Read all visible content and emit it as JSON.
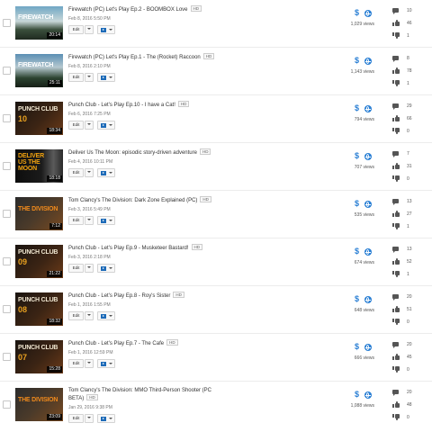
{
  "buttons": {
    "edit_label": "Edit"
  },
  "accent_color": "#2a7fd4",
  "videos": [
    {
      "title": "Firewatch (PC) Let's Play Ep.2 - BOOMBOX Love",
      "hd": "HD",
      "date": "Feb 8, 2016 5:50 PM",
      "duration": "20:14",
      "thumb_title": "FIREWATCH",
      "thumb_sub": "",
      "views": "1,029 views",
      "comments": "10",
      "likes": "46",
      "dislikes": "1"
    },
    {
      "title": "Firewatch (PC) Let's Play Ep.1 - The (Rocket) Raccoon",
      "hd": "HD",
      "date": "Feb 8, 2016 2:10 PM",
      "duration": "25:11",
      "thumb_title": "FIREWATCH",
      "thumb_sub": "",
      "views": "1,143 views",
      "comments": "8",
      "likes": "78",
      "dislikes": "1"
    },
    {
      "title": "Punch Club - Let's Play Ep.10 - I have a Cat!",
      "hd": "HD",
      "date": "Feb 6, 2016 7:25 PM",
      "duration": "18:34",
      "thumb_title": "PUNCH CLUB",
      "thumb_sub": "10",
      "views": "794 views",
      "comments": "29",
      "likes": "66",
      "dislikes": "0"
    },
    {
      "title": "Deliver Us The Moon: episodic story-driven adventure",
      "hd": "HD",
      "date": "Feb 4, 2016 10:11 PM",
      "duration": "18:18",
      "thumb_title": "DELIVER US THE MOON",
      "thumb_sub": "",
      "views": "707 views",
      "comments": "7",
      "likes": "31",
      "dislikes": "0"
    },
    {
      "title": "Tom Clancy's The Division: Dark Zone Explained (PC)",
      "hd": "HD",
      "date": "Feb 3, 2016 5:49 PM",
      "duration": "7:12",
      "thumb_title": "THE DIVISION",
      "thumb_sub": "",
      "views": "535 views",
      "comments": "13",
      "likes": "27",
      "dislikes": "1"
    },
    {
      "title": "Punch Club - Let's Play Ep.9 - Musketeer Bastard!",
      "hd": "HD",
      "date": "Feb 3, 2016 2:18 PM",
      "duration": "21:22",
      "thumb_title": "PUNCH CLUB",
      "thumb_sub": "09",
      "views": "674 views",
      "comments": "13",
      "likes": "52",
      "dislikes": "1"
    },
    {
      "title": "Punch Club - Let's Play Ep.8 - Roy's Sister",
      "hd": "HD",
      "date": "Feb 1, 2016 1:55 PM",
      "duration": "18:32",
      "thumb_title": "PUNCH CLUB",
      "thumb_sub": "08",
      "views": "648 views",
      "comments": "20",
      "likes": "51",
      "dislikes": "0"
    },
    {
      "title": "Punch Club - Let's Play Ep.7 - The Cafe",
      "hd": "HD",
      "date": "Feb 1, 2016 12:59 PM",
      "duration": "15:28",
      "thumb_title": "PUNCH CLUB",
      "thumb_sub": "07",
      "views": "666 views",
      "comments": "20",
      "likes": "45",
      "dislikes": "0"
    },
    {
      "title": "Tom Clancy's The Division: MMO Third-Person Shooter (PC BETA)",
      "hd": "HD",
      "date": "Jan 29, 2016 9:38 PM",
      "duration": "23:09",
      "thumb_title": "THE DIVISION",
      "thumb_sub": "",
      "views": "1,088 views",
      "comments": "20",
      "likes": "48",
      "dislikes": "0"
    }
  ]
}
